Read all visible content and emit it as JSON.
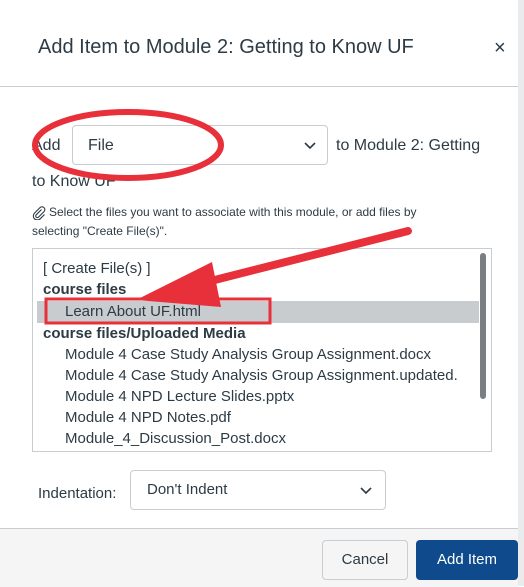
{
  "dialog": {
    "title": "Add Item to Module 2: Getting to Know UF",
    "close_icon": "close-icon"
  },
  "add_row": {
    "add_label": "Add",
    "type_value": "File",
    "to_module_line1": "to Module 2: Getting",
    "to_module_line2": "to Know UF"
  },
  "instructions": {
    "line1": "Select the files you want to associate with this module, or add files by",
    "line2": "selecting \"Create File(s)\".",
    "icon": "paperclip-icon"
  },
  "file_list": {
    "items": [
      {
        "label": "[ Create File(s) ]",
        "type": "option"
      },
      {
        "label": "course files",
        "type": "group"
      },
      {
        "label": "Learn About UF.html",
        "type": "option",
        "selected": true
      },
      {
        "label": "course files/Uploaded Media",
        "type": "group"
      },
      {
        "label": "Module 4 Case Study Analysis Group Assignment.docx",
        "type": "option"
      },
      {
        "label": "Module 4 Case Study Analysis Group Assignment.updated.",
        "type": "option"
      },
      {
        "label": "Module 4 NPD Lecture Slides.pptx",
        "type": "option"
      },
      {
        "label": "Module 4 NPD Notes.pdf",
        "type": "option"
      },
      {
        "label": "Module_4_Discussion_Post.docx",
        "type": "option"
      }
    ]
  },
  "indentation": {
    "label": "Indentation:",
    "value": "Don't Indent"
  },
  "footer": {
    "cancel_label": "Cancel",
    "add_item_label": "Add Item"
  },
  "colors": {
    "primary_button": "#0e4a8c",
    "annotation_red": "#e8303a",
    "selected_row": "#c9cccf"
  }
}
